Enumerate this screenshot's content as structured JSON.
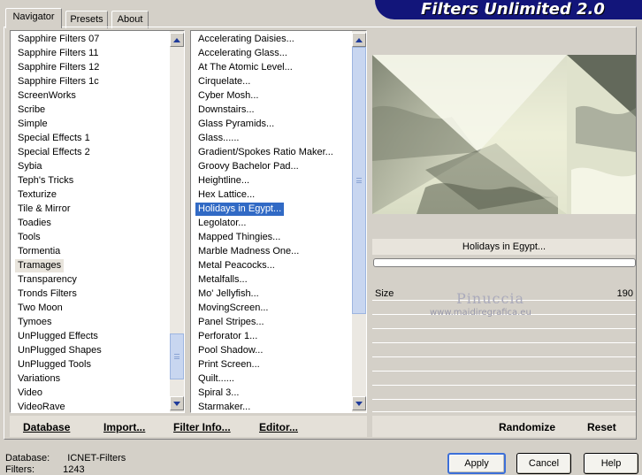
{
  "app": {
    "title": "Filters Unlimited 2.0"
  },
  "tabs": [
    {
      "label": "Navigator",
      "active": true
    },
    {
      "label": "Presets",
      "active": false
    },
    {
      "label": "About",
      "active": false
    }
  ],
  "categories": {
    "items": [
      "Sapphire Filters 07",
      "Sapphire Filters 11",
      "Sapphire Filters 12",
      "Sapphire Filters 1c",
      "ScreenWorks",
      "Scribe",
      "Simple",
      "Special Effects 1",
      "Special Effects 2",
      "Sybia",
      "Teph's Tricks",
      "Texturize",
      "Tile & Mirror",
      "Toadies",
      "Tools",
      "Tormentia",
      "Tramages",
      "Transparency",
      "Tronds Filters",
      "Two Moon",
      "Tymoes",
      "UnPlugged Effects",
      "UnPlugged Shapes",
      "UnPlugged Tools",
      "Variations",
      "Video",
      "VideoRave"
    ],
    "selected": "Tramages"
  },
  "filters": {
    "items": [
      "Accelerating Daisies...",
      "Accelerating Glass...",
      "At The Atomic Level...",
      "Cirquelate...",
      "Cyber Mosh...",
      "Downstairs...",
      "Glass Pyramids...",
      "Glass......",
      "Gradient/Spokes Ratio Maker...",
      "Groovy Bachelor Pad...",
      "Heightline...",
      "Hex Lattice...",
      "Holidays in Egypt...",
      "Legolator...",
      "Mapped Thingies...",
      "Marble Madness One...",
      "Metal Peacocks...",
      "Metalfalls...",
      "Mo' Jellyfish...",
      "MovingScreen...",
      "Panel Stripes...",
      "Perforator 1...",
      "Pool Shadow...",
      "Print Screen...",
      "Quilt......",
      "Spiral 3...",
      "Starmaker..."
    ],
    "selected": "Holidays in Egypt..."
  },
  "left_buttons": {
    "database": "Database",
    "import": "Import...",
    "filter_info": "Filter Info...",
    "editor": "Editor..."
  },
  "right_buttons": {
    "randomize": "Randomize",
    "reset": "Reset"
  },
  "preview": {
    "caption": "Holidays in Egypt...",
    "progress": 0
  },
  "params": [
    {
      "label": "Size",
      "value": "190"
    }
  ],
  "watermark": {
    "line1": "Pinuccia",
    "line2": "www.maidiregrafica.eu"
  },
  "status": {
    "database_label": "Database:",
    "database_value": "ICNET-Filters",
    "filters_label": "Filters:",
    "filters_value": "1243"
  },
  "dialog_buttons": {
    "apply": "Apply",
    "cancel": "Cancel",
    "help": "Help"
  },
  "colors": {
    "banner": "#12157a",
    "selection": "#316ac5",
    "dialog_bg": "#d4d0c8"
  }
}
